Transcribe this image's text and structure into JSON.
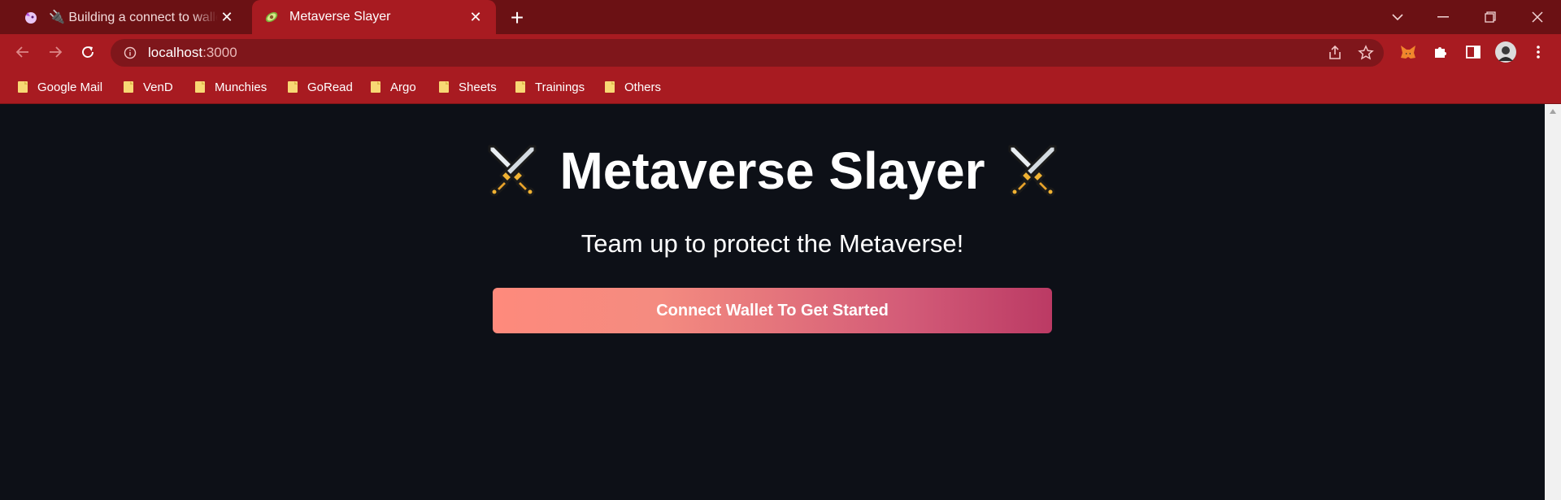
{
  "browser": {
    "tabs": [
      {
        "title": "🔌 Building a connect to wallet b",
        "icon": "unicorn-icon",
        "active": false
      },
      {
        "title": "Metaverse Slayer",
        "icon": "avocado-icon",
        "active": true
      }
    ],
    "new_tab_label": "+",
    "address": {
      "host": "localhost",
      "port": ":3000"
    },
    "bookmarks": [
      "Google Mail",
      "VenD",
      "Munchies",
      "GoRead",
      "Argo",
      "Sheets",
      "Trainings",
      "Others"
    ],
    "colors": {
      "frame": "#6b1114",
      "toolbar": "#a81b21",
      "omnibox": "#7f161b"
    }
  },
  "page": {
    "title": "Metaverse Slayer",
    "title_emoji": "⚔️",
    "subtitle": "Team up to protect the Metaverse!",
    "connect_button": "Connect Wallet To Get Started",
    "colors": {
      "background": "#0d1017",
      "button_start": "#fe8a7c",
      "button_end": "#bb3a64"
    }
  }
}
